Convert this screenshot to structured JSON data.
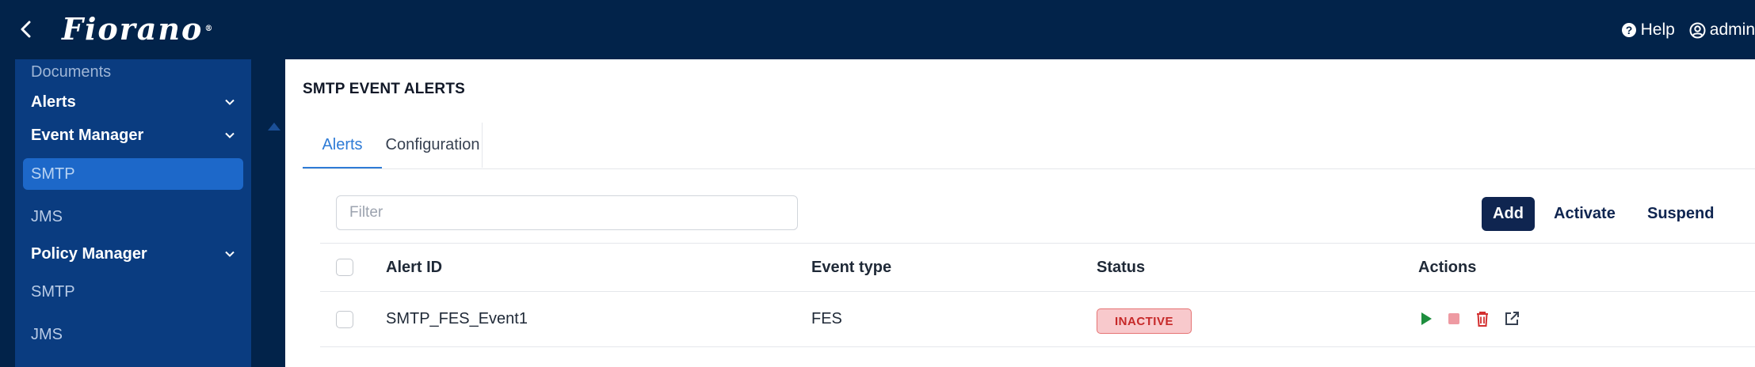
{
  "header": {
    "logo_text": "Fiorano",
    "help_label": "Help",
    "user_label": "admin"
  },
  "sidebar": {
    "items": [
      {
        "label": "Documents"
      },
      {
        "label": "Alerts"
      },
      {
        "label": "Event Manager"
      },
      {
        "label": "SMTP"
      },
      {
        "label": "JMS"
      },
      {
        "label": "Policy Manager"
      },
      {
        "label": "SMTP"
      },
      {
        "label": "JMS"
      }
    ]
  },
  "main": {
    "title": "SMTP EVENT ALERTS",
    "tabs": [
      {
        "label": "Alerts"
      },
      {
        "label": "Configuration"
      }
    ],
    "filter_placeholder": "Filter",
    "buttons": {
      "add": "Add",
      "activate": "Activate",
      "suspend": "Suspend"
    },
    "table": {
      "headers": [
        "Alert ID",
        "Event type",
        "Status",
        "Actions"
      ],
      "rows": [
        {
          "alert_id": "SMTP_FES_Event1",
          "event_type": "FES",
          "status": "INACTIVE"
        }
      ]
    }
  },
  "colors": {
    "topbar": "#02234a",
    "sidebar_panel": "#0a3c80",
    "sidebar_active": "#1d68c9",
    "accent": "#2e7bd6",
    "primary_button": "#0f2550",
    "status_inactive_bg": "#f8c9cc",
    "status_inactive_text": "#c62828",
    "play_icon": "#1e8e3e",
    "stop_icon": "#ee9aa2",
    "delete_icon": "#d32f2f"
  },
  "icons": [
    "back-arrow-icon",
    "help-icon",
    "user-icon",
    "chevron-down-icon",
    "play-icon",
    "stop-icon",
    "trash-icon",
    "external-link-icon"
  ]
}
